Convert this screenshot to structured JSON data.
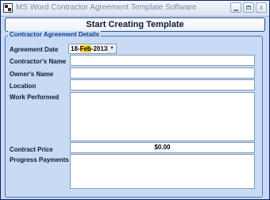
{
  "window": {
    "title": "MS Word Contractor Agreement Template Software",
    "controls": [
      "minimize",
      "maximize",
      "close"
    ],
    "close_glyph": "x"
  },
  "start_button": {
    "label": "Start Creating Template"
  },
  "details": {
    "group_title": "Contractor Agreement Details",
    "agreement_date": {
      "label": "Agreement Date",
      "day": "18-",
      "month": "Feb",
      "year": "-2013",
      "dropdown_icon": "chevron-down-icon"
    },
    "contractor_name": {
      "label": "Contractor's Name",
      "value": ""
    },
    "owner_name": {
      "label": "Owner's Name",
      "value": ""
    },
    "location": {
      "label": "Location",
      "value": ""
    },
    "work_performed": {
      "label": "Work Performed",
      "value": ""
    },
    "contract_price": {
      "label": "Contract Price",
      "value": "$0.00"
    },
    "progress_payments": {
      "label": "Progress Payments",
      "value": ""
    }
  }
}
